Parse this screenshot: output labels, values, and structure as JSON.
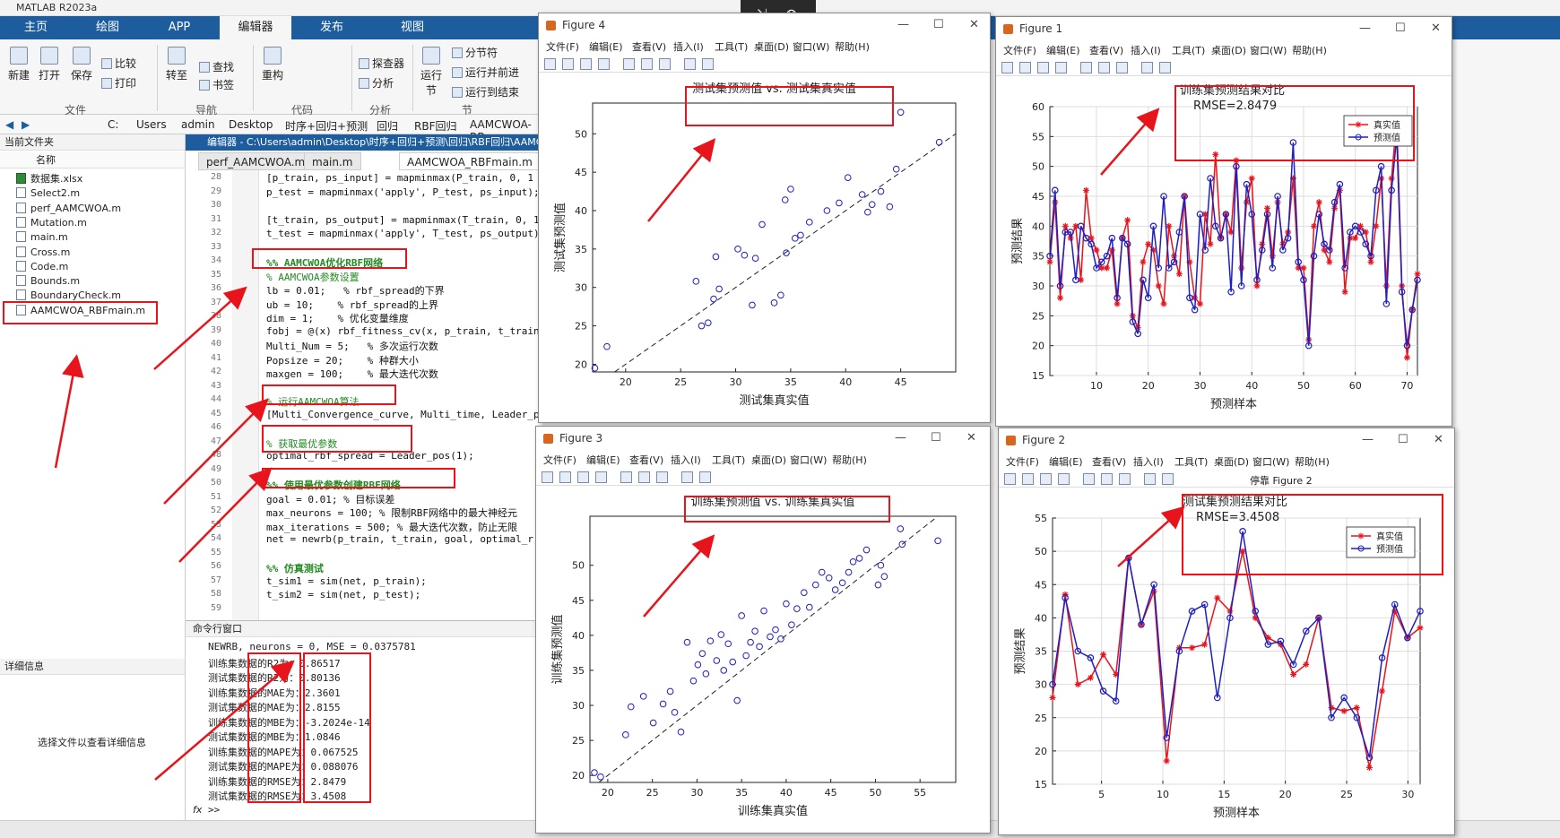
{
  "window_title": "MATLAB R2023a",
  "ribbon_tabs": [
    "主页",
    "绘图",
    "APP",
    "编辑器",
    "发布",
    "视图"
  ],
  "ribbon": {
    "new": "新建",
    "open": "打开",
    "save": "保存",
    "compare": "比较",
    "print": "打印",
    "goto": "转至",
    "find": "查找",
    "bookmark": "书签",
    "refactor": "重构",
    "debug": "探查器",
    "analyze": "分析",
    "run": "运行",
    "run_sub": "节",
    "section": "分节符",
    "run_advance": "运行并前进",
    "run_to_end": "运行到结束",
    "groups": [
      "文件",
      "导航",
      "代码",
      "分析",
      "节"
    ]
  },
  "address": {
    "drive": "C:",
    "crumbs": [
      "Users",
      "admin",
      "Desktop",
      "时序+回归+预测",
      "回归",
      "RBF回归",
      "AAMCWOA-RB"
    ]
  },
  "current_folder": {
    "title": "当前文件夹",
    "column": "名称",
    "files": [
      {
        "name": "数据集.xlsx",
        "type": "xlsx"
      },
      {
        "name": "Select2.m",
        "type": "m"
      },
      {
        "name": "perf_AAMCWOA.m",
        "type": "m"
      },
      {
        "name": "Mutation.m",
        "type": "m"
      },
      {
        "name": "main.m",
        "type": "m"
      },
      {
        "name": "Cross.m",
        "type": "m"
      },
      {
        "name": "Code.m",
        "type": "m"
      },
      {
        "name": "Bounds.m",
        "type": "m"
      },
      {
        "name": "BoundaryCheck.m",
        "type": "m"
      },
      {
        "name": "AAMCWOA_RBFmain.m",
        "type": "m"
      }
    ]
  },
  "details": {
    "title": "详细信息",
    "empty": "选择文件以查看详细信息"
  },
  "editor": {
    "header": "编辑器 - C:\\Users\\admin\\Desktop\\时序+回归+预测\\回归\\RBF回归\\AAMC",
    "tabs": [
      "perf_AAMCWOA.m",
      "main.m",
      "AAMCWOA_RBFmain.m"
    ],
    "lines": [
      {
        "n": "28",
        "t": "[p_train, ps_input] = mapminmax(P_train, 0, 1",
        "k": ""
      },
      {
        "n": "29",
        "t": "p_test = mapminmax('apply', P_test, ps_input);",
        "k": ""
      },
      {
        "n": "30",
        "t": "",
        "k": ""
      },
      {
        "n": "31",
        "t": "[t_train, ps_output] = mapminmax(T_train, 0, 1",
        "k": ""
      },
      {
        "n": "32",
        "t": "t_test = mapminmax('apply', T_test, ps_output)",
        "k": ""
      },
      {
        "n": "33",
        "t": "",
        "k": ""
      },
      {
        "n": "34",
        "t": "%% AAMCWOA优化RBF网络",
        "k": "b"
      },
      {
        "n": "35",
        "t": "% AAMCWOA参数设置",
        "k": "c"
      },
      {
        "n": "36",
        "t": "lb = 0.01;   % rbf_spread的下界",
        "k": ""
      },
      {
        "n": "37",
        "t": "ub = 10;    % rbf_spread的上界",
        "k": ""
      },
      {
        "n": "38",
        "t": "dim = 1;    % 优化变量维度",
        "k": ""
      },
      {
        "n": "39",
        "t": "fobj = @(x) rbf_fitness_cv(x, p_train, t_train",
        "k": ""
      },
      {
        "n": "40",
        "t": "Multi_Num = 5;   % 多次运行次数",
        "k": ""
      },
      {
        "n": "41",
        "t": "Popsize = 20;    % 种群大小",
        "k": ""
      },
      {
        "n": "42",
        "t": "maxgen = 100;    % 最大迭代次数",
        "k": ""
      },
      {
        "n": "43",
        "t": "",
        "k": ""
      },
      {
        "n": "44",
        "t": "% 运行AAMCWOA算法",
        "k": "c"
      },
      {
        "n": "45",
        "t": "[Multi_Convergence_curve, Multi_time, Leader_p",
        "k": ""
      },
      {
        "n": "46",
        "t": "",
        "k": ""
      },
      {
        "n": "47",
        "t": "% 获取最优参数",
        "k": "c"
      },
      {
        "n": "48",
        "t": "optimal_rbf_spread = Leader_pos(1);",
        "k": ""
      },
      {
        "n": "49",
        "t": "",
        "k": ""
      },
      {
        "n": "50",
        "t": "%% 使用最优参数创建RBF网络",
        "k": "b"
      },
      {
        "n": "51",
        "t": "goal = 0.01; % 目标误差",
        "k": ""
      },
      {
        "n": "52",
        "t": "max_neurons = 100; % 限制RBF网络中的最大神经元",
        "k": ""
      },
      {
        "n": "53",
        "t": "max_iterations = 500; % 最大迭代次数，防止无限",
        "k": ""
      },
      {
        "n": "54",
        "t": "net = newrb(p_train, t_train, goal, optimal_r",
        "k": ""
      },
      {
        "n": "55",
        "t": "",
        "k": ""
      },
      {
        "n": "56",
        "t": "%% 仿真测试",
        "k": "b"
      },
      {
        "n": "57",
        "t": "t_sim1 = sim(net, p_train);",
        "k": ""
      },
      {
        "n": "58",
        "t": "t_sim2 = sim(net, p_test);",
        "k": ""
      },
      {
        "n": "59",
        "t": "",
        "k": ""
      }
    ]
  },
  "command_window": {
    "title": "命令行窗口",
    "lines": [
      "NEWRB, neurons = 0, MSE = 0.0375781",
      "训练集数据的R2为：0.86517",
      "测试集数据的R2为：0.80136",
      "训练集数据的MAE为：2.3601",
      "测试集数据的MAE为：2.8155",
      "训练集数据的MBE为：-3.2024e-14",
      "测试集数据的MBE为：1.0846",
      "训练集数据的MAPE为：0.067525",
      "测试集数据的MAPE为：0.088076",
      "训练集数据的RMSE为：2.8479",
      "测试集数据的RMSE为：3.4508"
    ],
    "prompt": ">>"
  },
  "figure_menu": [
    "文件(F)",
    "编辑(E)",
    "查看(V)",
    "插入(I)",
    "工具(T)",
    "桌面(D)",
    "窗口(W)",
    "帮助(H)"
  ],
  "figures": {
    "fig4": {
      "title": "Figure 4"
    },
    "fig3": {
      "title": "Figure 3"
    },
    "fig1": {
      "title": "Figure 1"
    },
    "fig2": {
      "title": "Figure 2",
      "dock_label": "停靠 Figure 2"
    }
  },
  "chart_data": [
    {
      "id": "fig4",
      "type": "scatter",
      "title": "测试集预测值 vs. 测试集真实值",
      "xlabel": "测试集真实值",
      "ylabel": "测试集预测值",
      "xlim": [
        17,
        50
      ],
      "ylim": [
        19,
        54
      ],
      "xticks": [
        20,
        25,
        30,
        35,
        40,
        45
      ],
      "yticks": [
        20,
        25,
        30,
        35,
        40,
        45,
        50
      ],
      "diagonal": true,
      "x": [
        17.2,
        18.3,
        26.4,
        26.9,
        27.5,
        28.0,
        28.5,
        28.2,
        30.2,
        30.8,
        31.5,
        31.8,
        32.4,
        33.5,
        34.1,
        34.5,
        34.6,
        35.0,
        35.4,
        35.9,
        36.7,
        38.3,
        39.4,
        40.2,
        41.5,
        42.0,
        42.4,
        43.2,
        44.0,
        44.6,
        45.0,
        48.5
      ],
      "y": [
        19.5,
        22.3,
        30.8,
        25.0,
        25.4,
        28.5,
        29.8,
        34.0,
        35.0,
        34.2,
        27.7,
        33.8,
        38.2,
        28.0,
        29.0,
        41.4,
        34.5,
        42.8,
        36.4,
        36.8,
        38.5,
        40.0,
        41.0,
        44.3,
        42.1,
        39.8,
        40.8,
        42.5,
        40.5,
        45.4,
        52.8,
        48.9
      ]
    },
    {
      "id": "fig3",
      "type": "scatter",
      "title": "训练集预测值 vs. 训练集真实值",
      "xlabel": "训练集真实值",
      "ylabel": "训练集预测值",
      "xlim": [
        18,
        59
      ],
      "ylim": [
        19,
        57
      ],
      "xticks": [
        20,
        25,
        30,
        35,
        40,
        45,
        50,
        55
      ],
      "yticks": [
        20,
        25,
        30,
        35,
        40,
        45,
        50
      ],
      "diagonal": true,
      "x": [
        18.5,
        19.2,
        22.0,
        22.6,
        24.0,
        25.1,
        26.2,
        27.0,
        27.5,
        28.2,
        28.9,
        29.6,
        30.1,
        30.6,
        31.0,
        31.5,
        32.2,
        32.7,
        33.0,
        33.5,
        34.0,
        34.5,
        35.0,
        35.5,
        36.0,
        36.5,
        37.0,
        37.5,
        38.2,
        38.8,
        39.4,
        40.0,
        40.6,
        41.2,
        42.0,
        42.6,
        43.3,
        44.0,
        44.8,
        45.5,
        46.3,
        47.0,
        47.5,
        48.2,
        49.0,
        50.3,
        50.6,
        51.0,
        53.0,
        57.0,
        52.8
      ],
      "y": [
        20.4,
        19.8,
        25.8,
        29.8,
        31.3,
        27.5,
        30.2,
        32.0,
        29.0,
        26.2,
        39.0,
        33.5,
        35.8,
        37.4,
        34.5,
        39.2,
        36.4,
        40.1,
        35.0,
        38.8,
        36.2,
        30.7,
        42.8,
        37.1,
        39.0,
        40.6,
        38.4,
        43.5,
        39.8,
        40.8,
        39.5,
        44.5,
        41.5,
        43.8,
        46.1,
        44.0,
        47.2,
        49.0,
        48.2,
        46.5,
        47.5,
        49.0,
        50.5,
        51.0,
        52.2,
        47.2,
        50.0,
        48.4,
        53.0,
        53.5,
        55.2
      ]
    },
    {
      "id": "fig1",
      "type": "line",
      "title": "训练集预测结果对比",
      "subtitle": "RMSE=2.8479",
      "xlabel": "预测样本",
      "ylabel": "预测结果",
      "xlim": [
        1,
        72
      ],
      "ylim": [
        15,
        60
      ],
      "xticks": [
        10,
        20,
        30,
        40,
        50,
        60,
        70
      ],
      "yticks": [
        15,
        20,
        25,
        30,
        35,
        40,
        45,
        50,
        55,
        60
      ],
      "legend_position": "top-right",
      "series": [
        {
          "name": "真实值",
          "color": "#e8141b",
          "marker": "star",
          "values": [
            34,
            44,
            28,
            40,
            38,
            40,
            31,
            46,
            38,
            36,
            33,
            33,
            36,
            27,
            38,
            41,
            25,
            23,
            34,
            37,
            36,
            30,
            27,
            40,
            35,
            32,
            45,
            34,
            28,
            27,
            42,
            37,
            52,
            38,
            42,
            39,
            51,
            33,
            44,
            48,
            30,
            37,
            43,
            35,
            44,
            37,
            39,
            48,
            33,
            33,
            21,
            40,
            44,
            36,
            34,
            43,
            46,
            29,
            38,
            38,
            40,
            39,
            34,
            40,
            48,
            30,
            48,
            58,
            30,
            18,
            26,
            32
          ]
        },
        {
          "name": "预测值",
          "color": "#1f1fbf",
          "marker": "circle",
          "values": [
            35,
            46,
            30,
            39,
            39,
            31,
            40,
            38,
            37,
            33,
            34,
            35,
            38,
            28,
            38,
            37,
            24,
            22,
            31,
            28,
            40,
            33,
            45,
            33,
            34,
            39,
            45,
            28,
            26,
            42,
            36,
            48,
            40,
            38,
            42,
            29,
            50,
            30,
            47,
            42,
            31,
            36,
            42,
            33,
            45,
            36,
            38,
            54,
            34,
            31,
            20,
            35,
            42,
            37,
            36,
            44,
            47,
            33,
            39,
            40,
            39,
            37,
            35,
            46,
            50,
            27,
            46,
            55,
            29,
            20,
            26,
            31
          ]
        }
      ]
    },
    {
      "id": "fig2",
      "type": "line",
      "title": "测试集预测结果对比",
      "subtitle": "RMSE=3.4508",
      "xlabel": "预测样本",
      "ylabel": "预测结果",
      "xlim": [
        1,
        31
      ],
      "ylim": [
        15,
        55
      ],
      "xticks": [
        5,
        10,
        15,
        20,
        25,
        30
      ],
      "yticks": [
        15,
        20,
        25,
        30,
        35,
        40,
        45,
        50,
        55
      ],
      "legend_position": "top-right",
      "series": [
        {
          "name": "真实值",
          "color": "#e8141b",
          "marker": "star",
          "values": [
            28,
            43.5,
            30,
            31,
            34.5,
            31.5,
            49,
            39,
            44,
            18.5,
            35.5,
            35.5,
            36,
            43,
            41,
            50,
            40,
            37,
            36,
            31.5,
            33,
            40,
            26.5,
            26,
            26.5,
            17.5,
            29,
            41,
            37,
            38.5
          ]
        },
        {
          "name": "预测值",
          "color": "#1f1fbf",
          "marker": "circle",
          "values": [
            30,
            43,
            35,
            34,
            29,
            27.5,
            49,
            39,
            45,
            22,
            35,
            41,
            42,
            28,
            40,
            53,
            41,
            36,
            36.5,
            33,
            38,
            40,
            25,
            28,
            25,
            19,
            34,
            42,
            37,
            41
          ]
        }
      ]
    }
  ]
}
